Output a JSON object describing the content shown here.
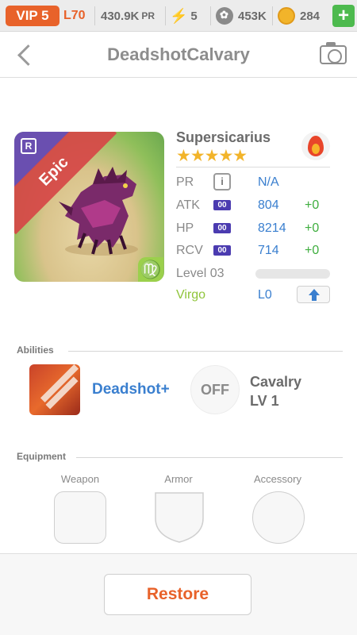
{
  "status_bar": {
    "vip": "VIP 5",
    "level": "L70",
    "power": "430.9K",
    "power_unit": "PR",
    "energy": "5",
    "paw_count": "453K",
    "coins": "284",
    "add": "+"
  },
  "header": {
    "title": "DeadshotCalvary"
  },
  "monster": {
    "rarity": "Epic",
    "rank_badge": "R",
    "zodiac_symbol": "♍",
    "name": "Supersicarius",
    "stars": "★★★★★",
    "stats": [
      {
        "label": "PR",
        "value": "N/A"
      },
      {
        "label": "ATK",
        "badge": "00",
        "value": "804",
        "bonus": "+0"
      },
      {
        "label": "HP",
        "badge": "00",
        "value": "8214",
        "bonus": "+0"
      },
      {
        "label": "RCV",
        "badge": "00",
        "value": "714",
        "bonus": "+0"
      }
    ],
    "info_glyph": "i",
    "level_label": "Level 03",
    "level_progress": 0.0,
    "sign": "Virgo",
    "sign_level": "L0"
  },
  "abilities": {
    "title": "Abilities",
    "skill": "Deadshot+",
    "leader_state": "OFF",
    "leader_name": "Cavalry",
    "leader_level": "LV 1"
  },
  "equipment": {
    "title": "Equipment",
    "weapon": "Weapon",
    "armor": "Armor",
    "accessory": "Accessory"
  },
  "footer": {
    "restore": "Restore"
  },
  "colors": {
    "accent_orange": "#e8622a",
    "link_blue": "#3a7fcf",
    "bonus_green": "#3fae3f",
    "virgo_green": "#8fc43a",
    "epic_red": "#d64646"
  }
}
